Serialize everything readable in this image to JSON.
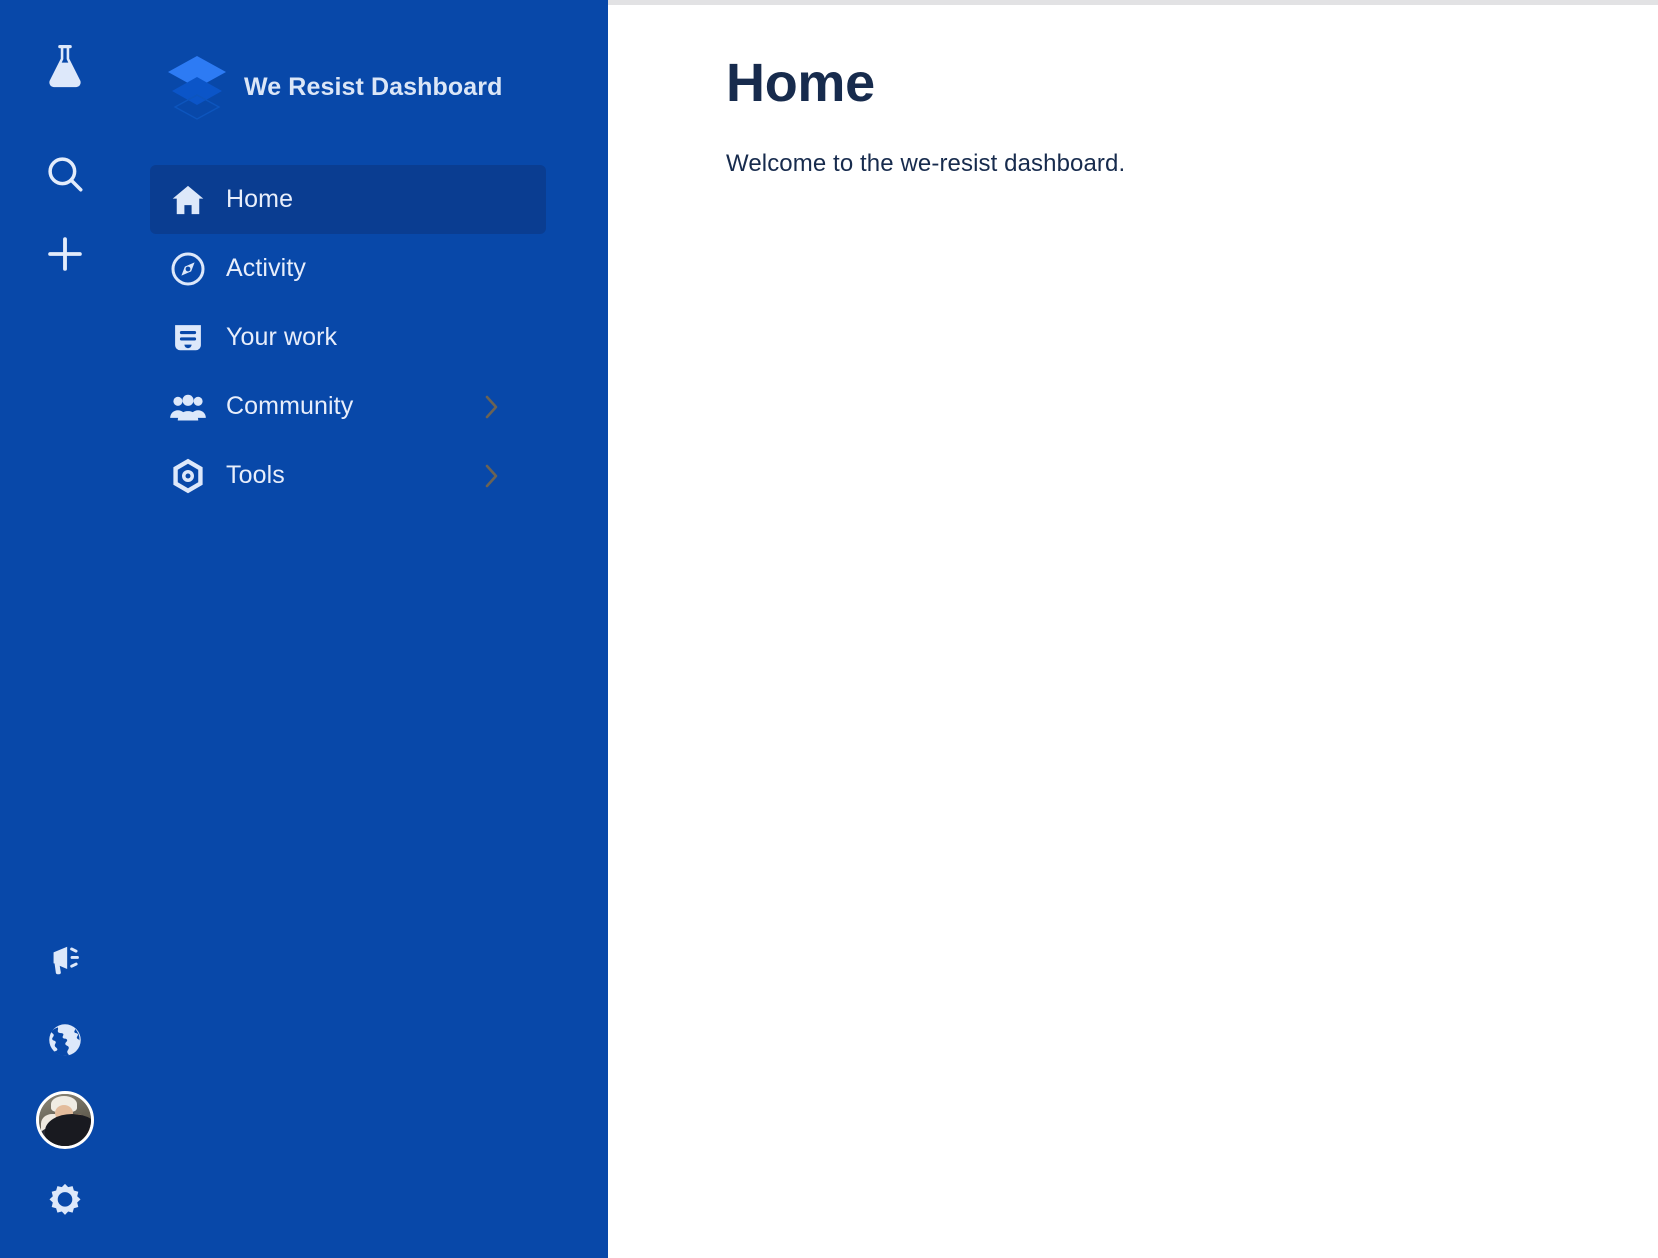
{
  "brand": {
    "title": "We Resist Dashboard",
    "logo_icon": "layers-icon",
    "logo_color_top": "#2d7bf4",
    "logo_color_mid": "#0b55c8",
    "logo_color_bottom": "#0a4bb0"
  },
  "theme": {
    "sidebar_bg": "#0848a9",
    "sidebar_selected_bg": "#0a3d91",
    "sidebar_text": "#e8eefb",
    "chevron_color": "#6b6354",
    "content_bg": "#ffffff",
    "heading_color": "#172b4d",
    "top_strip": "#e2e2e4"
  },
  "rail": {
    "top_items": [
      {
        "name": "flask-icon",
        "label": "Lab"
      },
      {
        "name": "search-icon",
        "label": "Search"
      },
      {
        "name": "plus-icon",
        "label": "Create"
      }
    ],
    "bottom_items": [
      {
        "name": "megaphone-icon",
        "label": "Announcements"
      },
      {
        "name": "globe-icon",
        "label": "Language"
      },
      {
        "name": "avatar",
        "label": "Profile"
      },
      {
        "name": "gear-icon",
        "label": "Settings"
      }
    ]
  },
  "sidebar": {
    "items": [
      {
        "label": "Home",
        "icon": "home-icon",
        "selected": true,
        "has_chevron": false
      },
      {
        "label": "Activity",
        "icon": "compass-icon",
        "selected": false,
        "has_chevron": false
      },
      {
        "label": "Your work",
        "icon": "board-icon",
        "selected": false,
        "has_chevron": false
      },
      {
        "label": "Community",
        "icon": "people-icon",
        "selected": false,
        "has_chevron": true
      },
      {
        "label": "Tools",
        "icon": "hexagon-icon",
        "selected": false,
        "has_chevron": true
      }
    ]
  },
  "main": {
    "title": "Home",
    "description": "Welcome to the we-resist dashboard."
  }
}
